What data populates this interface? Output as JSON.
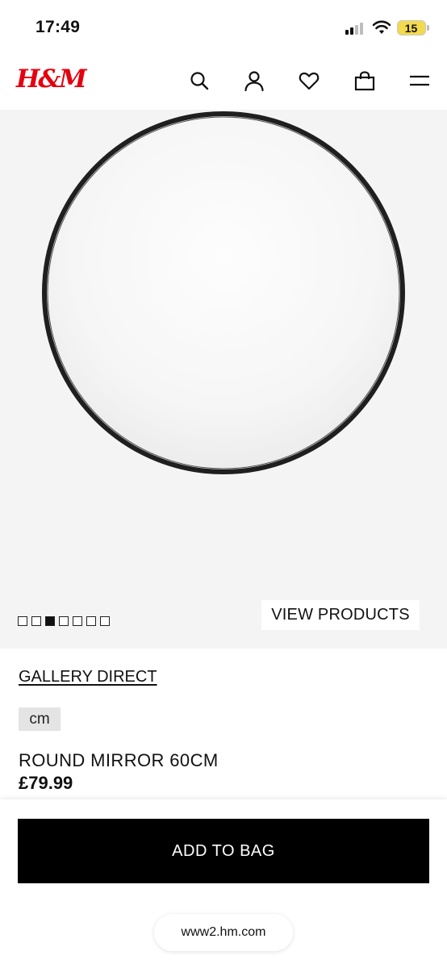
{
  "status_bar": {
    "time": "17:49",
    "battery": "15",
    "battery_color": "#f3d94e"
  },
  "header": {
    "logo": "H&M",
    "logo_color": "#e50010",
    "icons": [
      "search-icon",
      "account-icon",
      "heart-icon",
      "bag-icon",
      "menu-icon"
    ]
  },
  "gallery": {
    "image_count": 7,
    "active_index": 2,
    "view_products_label": "VIEW PRODUCTS"
  },
  "product": {
    "brand": "GALLERY DIRECT",
    "unit": "cm",
    "name": "ROUND MIRROR 60CM",
    "price": "£79.99"
  },
  "actions": {
    "add_to_bag_label": "ADD TO BAG"
  },
  "browser": {
    "url": "www2.hm.com"
  }
}
